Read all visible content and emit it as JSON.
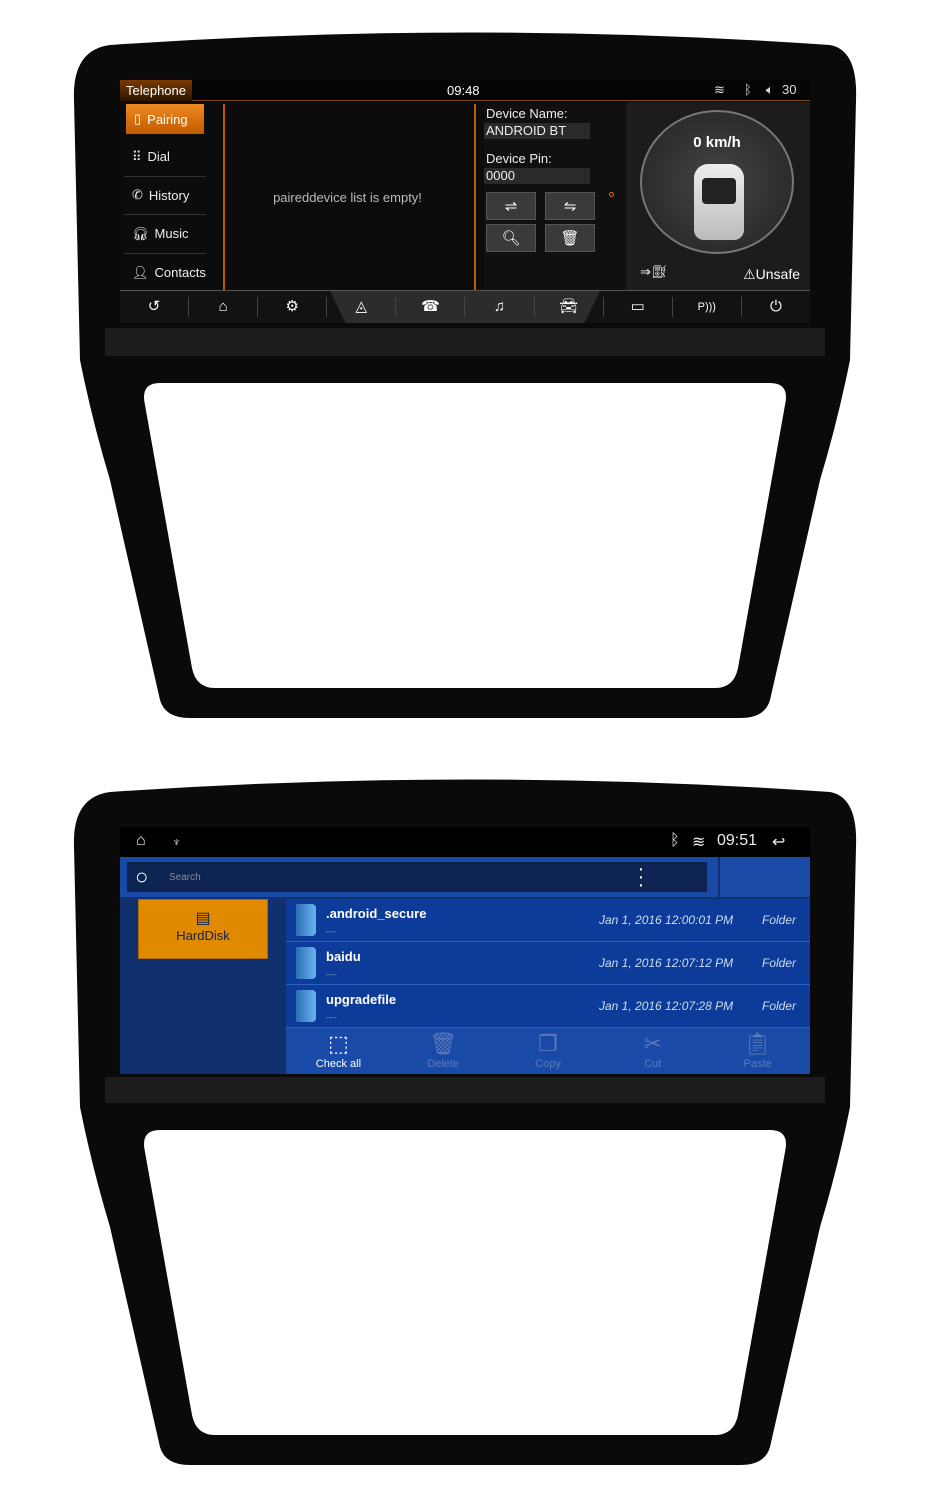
{
  "top_screen": {
    "status_bar": {
      "app_title": "Telephone",
      "time": "09:48",
      "wifi_icon": "wifi-icon",
      "bluetooth_icon": "bluetooth-icon",
      "volume": "30"
    },
    "sidebar": {
      "items": [
        {
          "label": "Pairing",
          "icon": "phone-icon",
          "active": true
        },
        {
          "label": "Dial",
          "icon": "keypad-icon"
        },
        {
          "label": "History",
          "icon": "call-history-icon"
        },
        {
          "label": "Music",
          "icon": "headphones-icon"
        },
        {
          "label": "Contacts",
          "icon": "person-icon"
        }
      ]
    },
    "device_list_empty": "paireddevice list is empty!",
    "device_name_label": "Device Name:",
    "device_name": "ANDROID BT",
    "device_pin_label": "Device Pin:",
    "device_pin": "0000",
    "car_status": {
      "speed": "0 km/h",
      "seatbelt": "Unsafe"
    },
    "nav_bar": [
      "back",
      "home",
      "settings",
      "navigation",
      "phone",
      "media",
      "car",
      "camera",
      "parking-sensor",
      "power"
    ],
    "accent": "#e07000"
  },
  "bottom_screen": {
    "status_bar": {
      "time": "09:51"
    },
    "search": {
      "placeholder": "Search"
    },
    "storage": {
      "label": "HardDisk"
    },
    "files": [
      {
        "name": ".android_secure",
        "sub": "----",
        "date": "Jan 1, 2016 12:00:01 PM",
        "type": "Folder"
      },
      {
        "name": "baidu",
        "sub": "----",
        "date": "Jan 1, 2016 12:07:12 PM",
        "type": "Folder"
      },
      {
        "name": "upgradefile",
        "sub": "----",
        "date": "Jan 1, 2016 12:07:28 PM",
        "type": "Folder"
      }
    ],
    "toolbar": [
      {
        "label": "Check all",
        "enabled": true
      },
      {
        "label": "Delete",
        "enabled": false
      },
      {
        "label": "Copy",
        "enabled": false
      },
      {
        "label": "Cut",
        "enabled": false
      },
      {
        "label": "Paste",
        "enabled": false
      }
    ],
    "accent": "#e08a00"
  }
}
